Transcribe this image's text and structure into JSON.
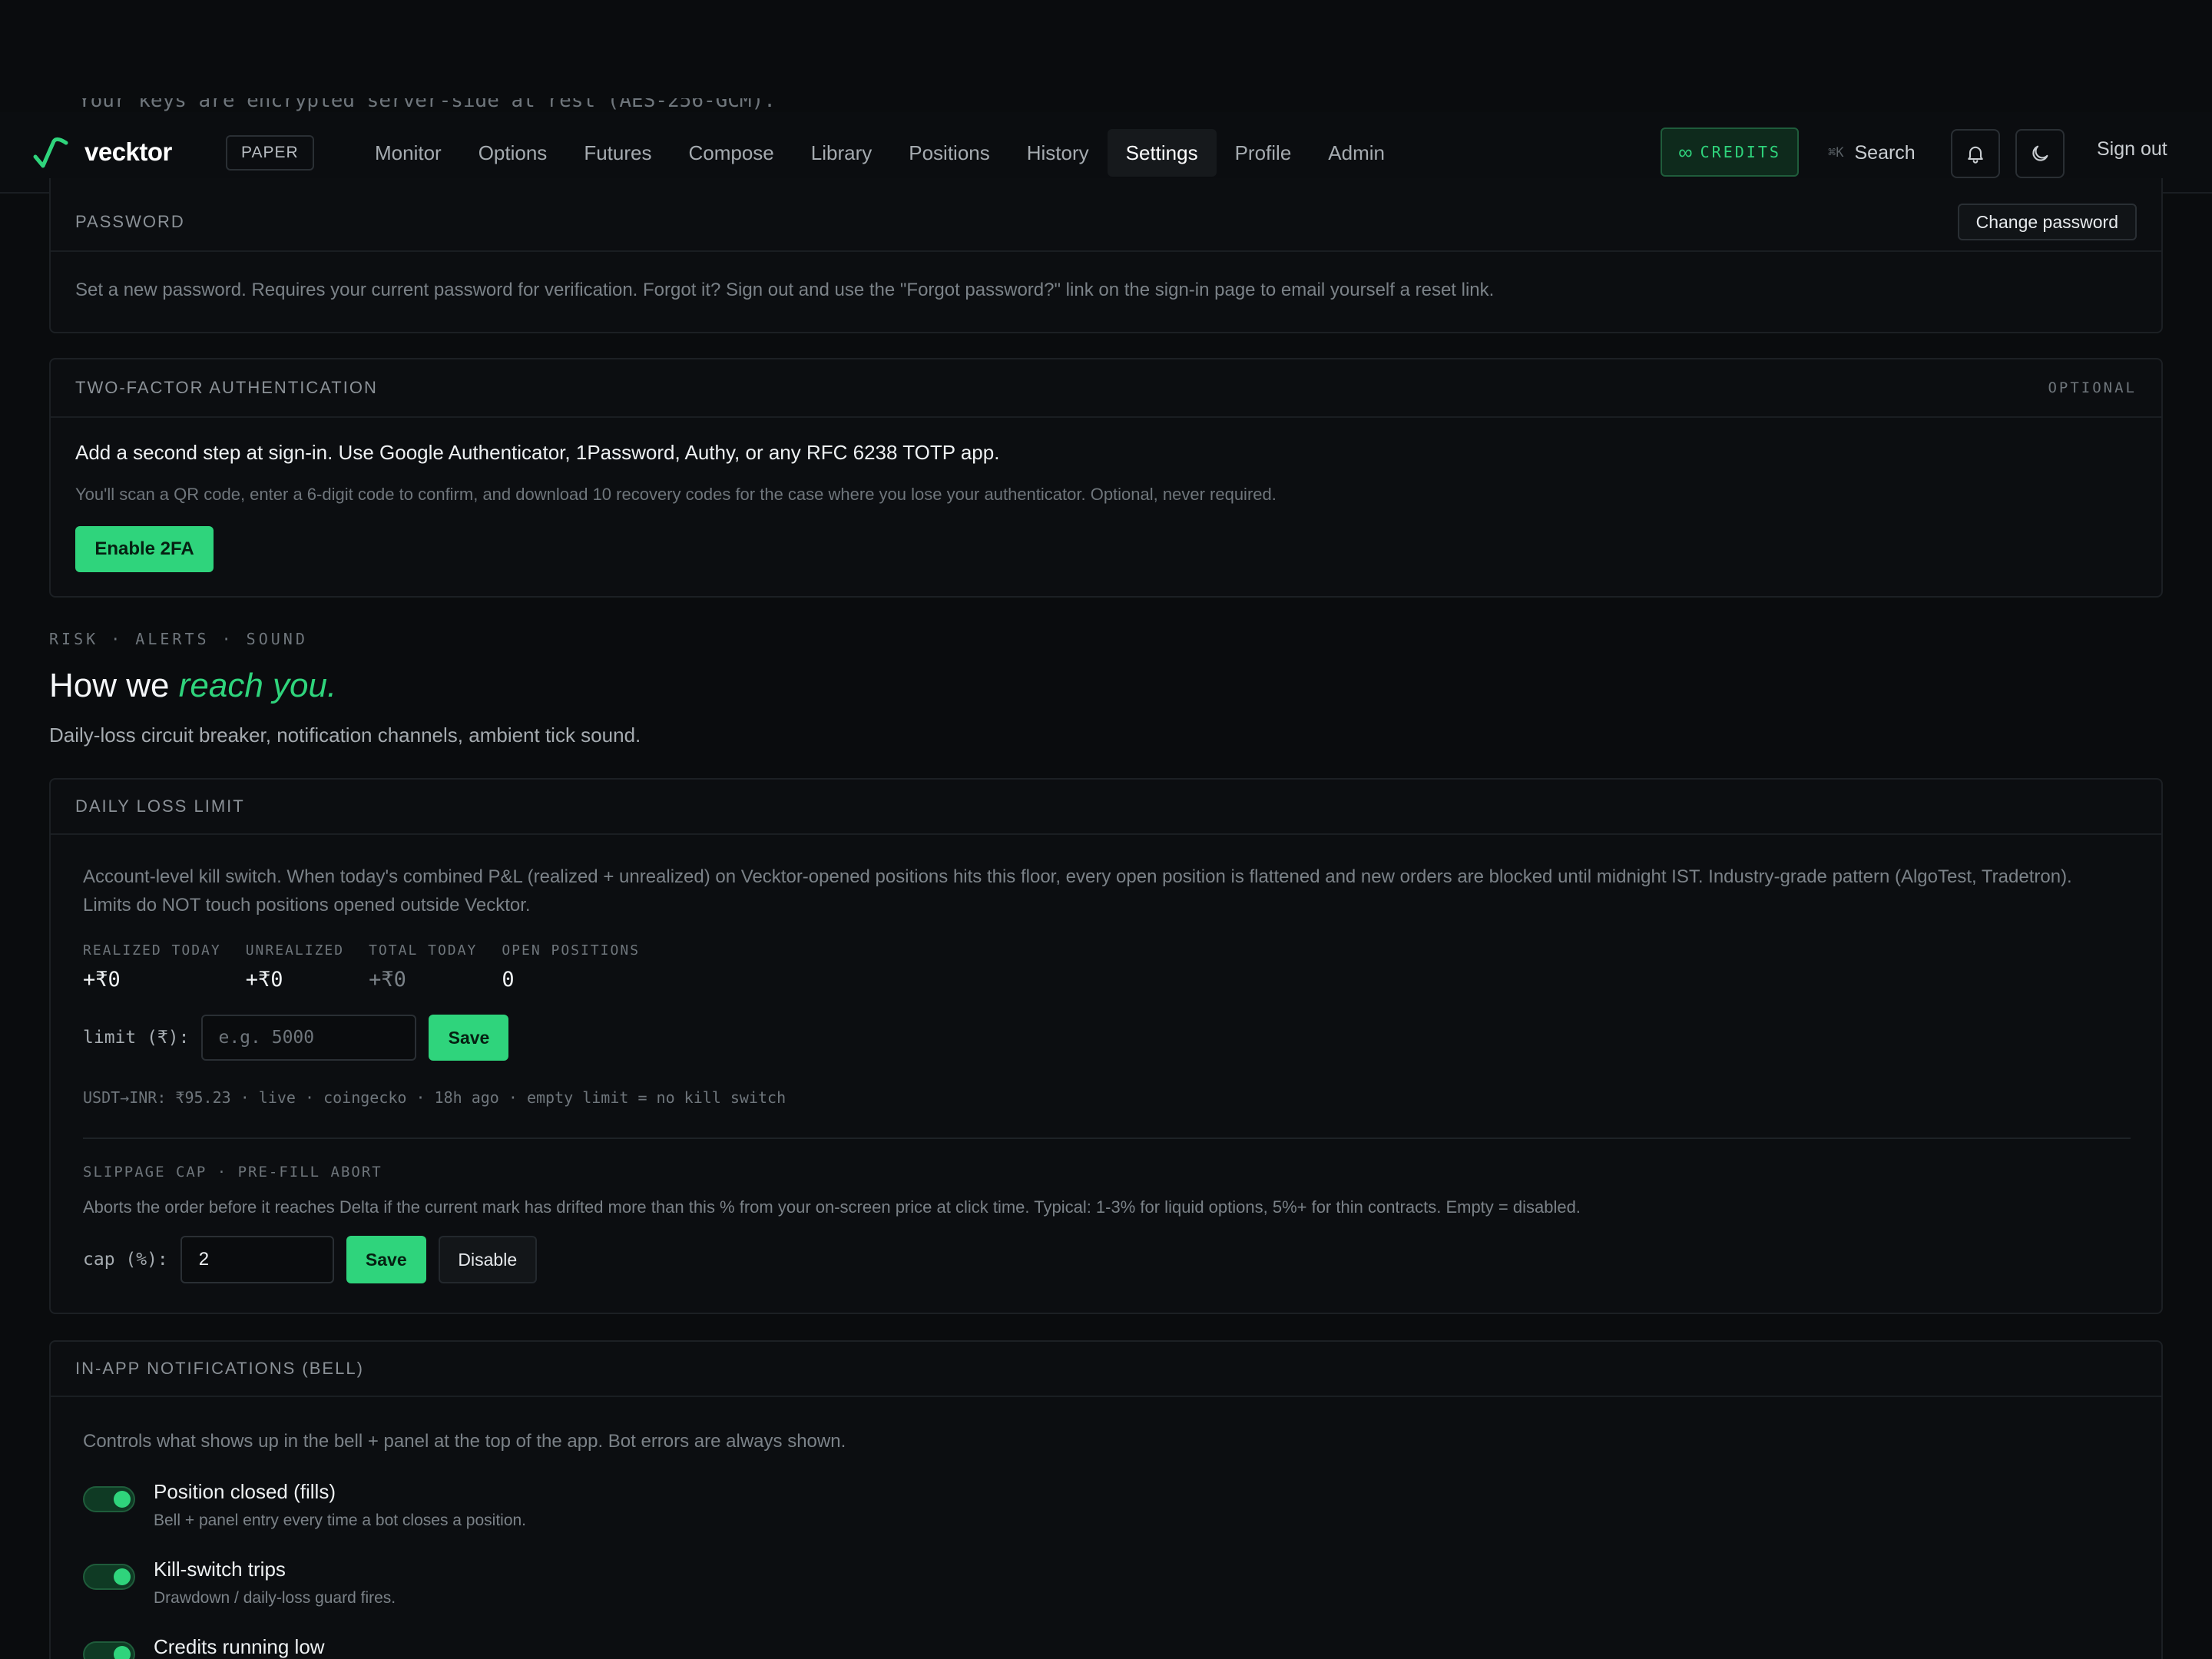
{
  "clipped_text": "Your keys are encrypted server-side at rest (AES-256-GCM).",
  "nav": {
    "brand": "vecktor",
    "mode": "PAPER",
    "links": [
      "Monitor",
      "Options",
      "Futures",
      "Compose",
      "Library",
      "Positions",
      "History",
      "Settings",
      "Profile",
      "Admin"
    ],
    "active": "Settings",
    "credits_symbol": "∞",
    "credits_label": "CREDITS",
    "search_kbd": "⌘K",
    "search_label": "Search",
    "signout": "Sign out"
  },
  "password": {
    "title": "PASSWORD",
    "button": "Change password",
    "desc": "Set a new password. Requires your current password for verification. Forgot it? Sign out and use the \"Forgot password?\" link on the sign-in page to email yourself a reset link."
  },
  "twofa": {
    "title": "TWO-FACTOR AUTHENTICATION",
    "tag": "OPTIONAL",
    "main": "Add a second step at sign-in. Use Google Authenticator, 1Password, Authy, or any RFC 6238 TOTP app.",
    "sub": "You'll scan a QR code, enter a 6-digit code to confirm, and download 10 recovery codes for the case where you lose your authenticator. Optional, never required.",
    "button": "Enable 2FA"
  },
  "section": {
    "kicker": "RISK · ALERTS · SOUND",
    "title_plain": "How we ",
    "title_accent": "reach you.",
    "desc": "Daily-loss circuit breaker, notification channels, ambient tick sound."
  },
  "daily_loss": {
    "title": "DAILY LOSS LIMIT",
    "desc_line1": "Account-level kill switch. When today's combined P&L (realized + unrealized) on Vecktor-opened positions hits this floor, every open position is flattened and new orders are blocked until midnight IST. Industry-grade pattern (AlgoTest, Tradetron).",
    "desc_line2": "Limits do NOT touch positions opened outside Vecktor.",
    "stats": [
      {
        "label": "REALIZED TODAY",
        "value": "+₹0"
      },
      {
        "label": "UNREALIZED",
        "value": "+₹0"
      },
      {
        "label": "TOTAL TODAY",
        "value": "+₹0"
      },
      {
        "label": "OPEN POSITIONS",
        "value": "0"
      }
    ],
    "limit_label": "limit (₹):",
    "limit_placeholder": "e.g. 5000",
    "save": "Save",
    "rate_line": "USDT→INR: ₹95.23 · live · coingecko · 18h ago · empty limit = no kill switch",
    "slippage_kicker": "SLIPPAGE CAP · PRE-FILL ABORT",
    "slippage_desc": "Aborts the order before it reaches Delta if the current mark has drifted more than this % from your on-screen price at click time. Typical: 1-3% for liquid options, 5%+ for thin contracts. Empty = disabled.",
    "cap_label": "cap (%):",
    "cap_value": "2",
    "cap_save": "Save",
    "disable": "Disable"
  },
  "notifications": {
    "title": "IN-APP NOTIFICATIONS (BELL)",
    "desc": "Controls what shows up in the bell + panel at the top of the app. Bot errors are always shown.",
    "items": [
      {
        "title": "Position closed (fills)",
        "sub": "Bell + panel entry every time a bot closes a position.",
        "on": true
      },
      {
        "title": "Kill-switch trips",
        "sub": "Drawdown / daily-loss guard fires.",
        "on": true
      },
      {
        "title": "Credits running low",
        "sub": "",
        "on": true
      }
    ]
  },
  "colors": {
    "accent": "#2fd47c",
    "background": "#0a0c0e",
    "card": "#0c0e11"
  }
}
